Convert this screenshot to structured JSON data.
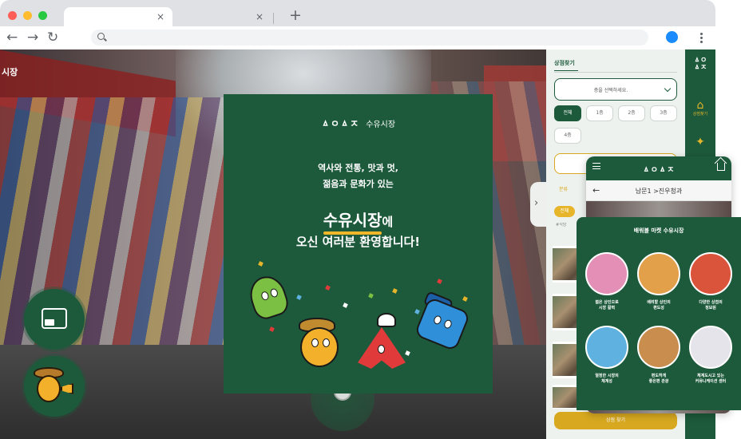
{
  "browser": {
    "tab_close_glyph": "×",
    "new_tab_glyph": "+",
    "back_glyph": "←",
    "forward_glyph": "→",
    "reload_glyph": "↻",
    "icons": [
      "search-icon",
      "profile-icon",
      "kebab-menu-icon"
    ],
    "profile_color": "#1a8cff"
  },
  "viewport": {
    "sign_text": "시장",
    "side_handle_glyph": "›"
  },
  "welcome": {
    "logo_mark": "ㅿㅇㅿㅈ",
    "logo_name": "수유시장",
    "tagline_1": "역사와 전통, 맛과 멋,",
    "tagline_2": "젊음과 문화가 있는",
    "brand_name": "수유시장",
    "brand_suffix": "에",
    "message": "오신 여러분 환영합니다!",
    "accent": "#f0b72b",
    "background": "#1d5a3b"
  },
  "panel": {
    "tab_label": "상점찾기",
    "select_placeholder": "층을 선택하세요.",
    "floors": [
      "전체",
      "1층",
      "2층",
      "3층",
      "4층"
    ],
    "category_tab": "분류",
    "category_pill": "전체",
    "category_chip": "#식당",
    "bottom_button": "상점 찾기"
  },
  "rail": {
    "logo": "ㅿㅇ\nㅿㅈ",
    "items": [
      {
        "icon": "store-icon",
        "glyph": "⌂",
        "label": "상점찾기"
      },
      {
        "icon": "map-icon",
        "glyph": "✦",
        "label": ""
      }
    ]
  },
  "phone": {
    "logo": "ㅿㅇㅿㅈ",
    "back_glyph": "←",
    "title": "남문1 >진우청과"
  },
  "overlay": {
    "title": "배워볼 마켓 수유시장",
    "items": [
      {
        "label": "젊은 상인으로\n시장 활력",
        "color": "#e48fb6"
      },
      {
        "label": "배려할 상인의\n편도성",
        "color": "#e3a04a"
      },
      {
        "label": "다양한 상점의\n정보원",
        "color": "#d9543a"
      },
      {
        "label": "열정한 시장의\n체계성",
        "color": "#5fb2e0"
      },
      {
        "label": "편도하게\n좋은편 관광",
        "color": "#c98d4d"
      },
      {
        "label": "체계도시고 있는\n커뮤니케이션 센터",
        "color": "#e4e4ea"
      }
    ]
  }
}
